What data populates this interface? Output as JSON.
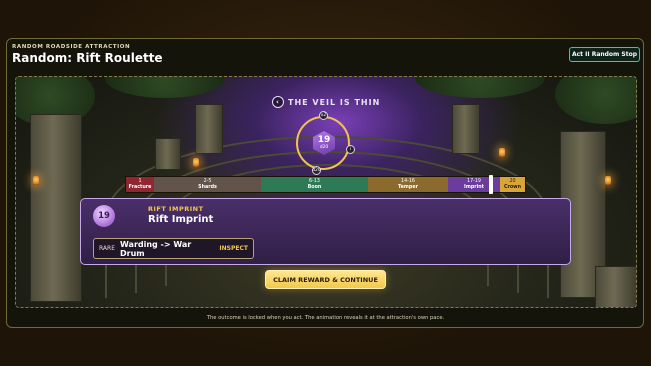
{
  "header": {
    "eyebrow": "RANDOM ROADSIDE ATTRACTION",
    "title": "Random: Rift Roulette",
    "act_badge": "Act II Random Stop"
  },
  "scene": {
    "veil_text": "THE VEIL IS THIN",
    "back_icon": "chevron-left-icon",
    "die": {
      "value": "19",
      "type": "d20"
    },
    "chips": {
      "multiplier": "x2",
      "info": "i",
      "die_type": "d20"
    }
  },
  "roll_track": {
    "segments": [
      {
        "range": "1",
        "label": "Fracture",
        "color": "#8f2630"
      },
      {
        "range": "2-5",
        "label": "Shards",
        "color": "#62544a"
      },
      {
        "range": "6-13",
        "label": "Boon",
        "color": "#2e7a56"
      },
      {
        "range": "14-16",
        "label": "Temper",
        "color": "#8c6a2e"
      },
      {
        "range": "17-19",
        "label": "Imprint",
        "color": "#6a3c9e"
      },
      {
        "range": "20",
        "label": "Crown",
        "color": "#d9a534"
      }
    ],
    "result": 19
  },
  "result_card": {
    "die_value": "19",
    "eyebrow": "RIFT IMPRINT",
    "title": "Rift Imprint",
    "swap": {
      "rarity": "RARE",
      "change": "Warding -> War Drum",
      "inspect_label": "INSPECT"
    }
  },
  "claim_button": "CLAIM REWARD & CONTINUE",
  "footnote": "The outcome is locked when you act. The animation reveals it at the attraction's own pace."
}
